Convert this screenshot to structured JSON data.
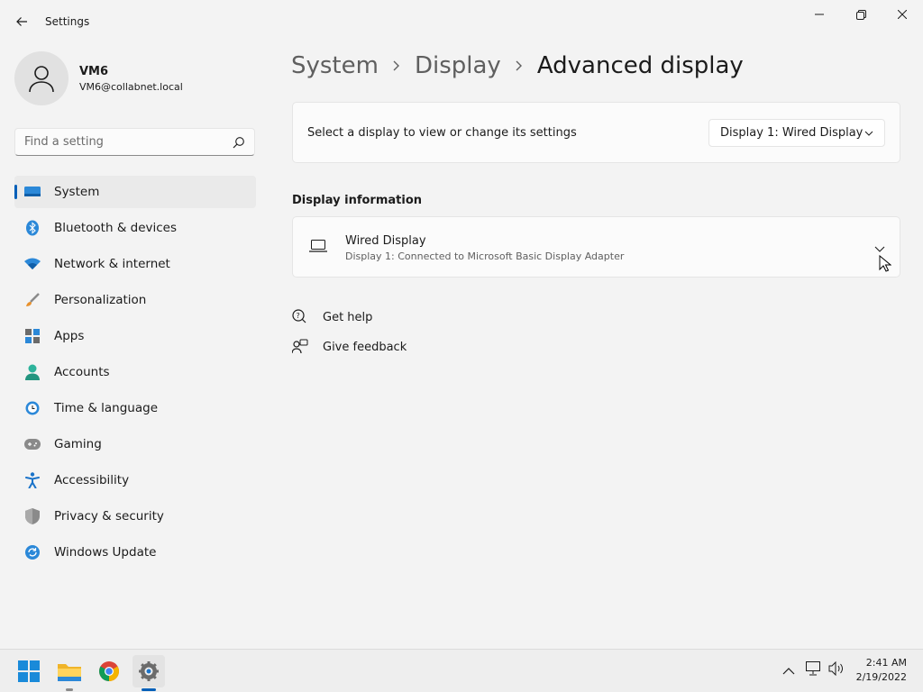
{
  "window": {
    "title": "Settings"
  },
  "profile": {
    "name": "VM6",
    "email": "VM6@collabnet.local"
  },
  "search": {
    "placeholder": "Find a setting"
  },
  "sidebar": {
    "items": [
      {
        "label": "System",
        "icon": "system-icon",
        "active": true
      },
      {
        "label": "Bluetooth & devices",
        "icon": "bluetooth-icon"
      },
      {
        "label": "Network & internet",
        "icon": "wifi-icon"
      },
      {
        "label": "Personalization",
        "icon": "brush-icon"
      },
      {
        "label": "Apps",
        "icon": "apps-icon"
      },
      {
        "label": "Accounts",
        "icon": "accounts-icon"
      },
      {
        "label": "Time & language",
        "icon": "clock-globe-icon"
      },
      {
        "label": "Gaming",
        "icon": "gamepad-icon"
      },
      {
        "label": "Accessibility",
        "icon": "accessibility-icon"
      },
      {
        "label": "Privacy & security",
        "icon": "shield-icon"
      },
      {
        "label": "Windows Update",
        "icon": "update-icon"
      }
    ]
  },
  "breadcrumb": {
    "items": [
      "System",
      "Display",
      "Advanced display"
    ]
  },
  "display_select": {
    "label": "Select a display to view or change its settings",
    "value": "Display 1: Wired Display"
  },
  "display_info": {
    "section_title": "Display information",
    "title": "Wired Display",
    "subtitle": "Display 1: Connected to Microsoft Basic Display Adapter"
  },
  "links": {
    "get_help": "Get help",
    "give_feedback": "Give feedback"
  },
  "taskbar": {
    "apps": [
      "start-icon",
      "file-explorer-icon",
      "chrome-icon",
      "settings-icon"
    ],
    "time": "2:41 AM",
    "date": "2/19/2022"
  },
  "colors": {
    "accent": "#005fb8",
    "background": "#f3f3f3",
    "card": "#fbfbfb"
  }
}
